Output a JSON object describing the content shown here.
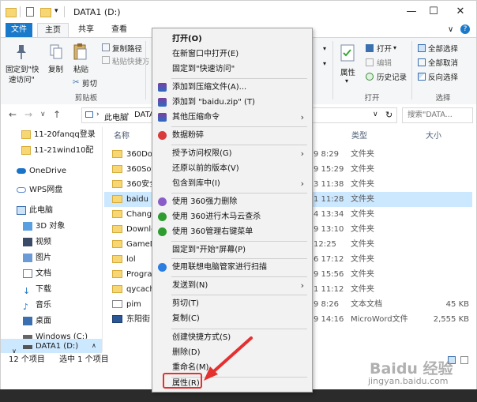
{
  "titlebar": {
    "title": "DATA1 (D:)",
    "minimize": "—",
    "maximize": "☐",
    "close": "✕"
  },
  "ribbon_tabs": {
    "file": "文件",
    "home": "主页",
    "share": "共享",
    "view": "查看"
  },
  "ribbon": {
    "pin_label": "固定到\"快",
    "pin_label2": "速访问\"",
    "copy_label": "复制",
    "paste_label": "粘贴",
    "copy_path": "复制路径",
    "paste_shortcut": "粘贴快捷方",
    "cut": "剪切",
    "clipboard_group": "剪贴板",
    "open": "打开",
    "edit": "编辑",
    "history": "历史记录",
    "properties": "属性",
    "open_group": "打开",
    "select_all": "全部选择",
    "select_none": "全部取消",
    "invert": "反向选择",
    "select_group": "选择"
  },
  "nav": {
    "back": "←",
    "forward": "→",
    "up_chevron": "∨",
    "up": "↑",
    "breadcrumb_pc": "此电脑",
    "breadcrumb_drive": "DATA",
    "search_placeholder": "搜索\"DATA...",
    "addr_chevron": "∨",
    "refresh": "↻"
  },
  "navpane": [
    {
      "label": "11-20fanqq登录",
      "kind": "folder"
    },
    {
      "label": "11-21wind10配",
      "kind": "folder"
    },
    {
      "label": "OneDrive",
      "kind": "cloud"
    },
    {
      "label": "WPS网盘",
      "kind": "cloud2"
    },
    {
      "label": "此电脑",
      "kind": "pc"
    },
    {
      "label": "3D 对象",
      "kind": "obj"
    },
    {
      "label": "视频",
      "kind": "video"
    },
    {
      "label": "图片",
      "kind": "pic"
    },
    {
      "label": "文档",
      "kind": "doc"
    },
    {
      "label": "下载",
      "kind": "dl"
    },
    {
      "label": "音乐",
      "kind": "music"
    },
    {
      "label": "桌面",
      "kind": "desk"
    },
    {
      "label": "Windows (C:)",
      "kind": "drive"
    },
    {
      "label": "DATA1 (D:)",
      "kind": "drive"
    }
  ],
  "columns": {
    "name": "名称",
    "type": "类型",
    "size": "大小"
  },
  "files": [
    {
      "name": "360Dov",
      "date": "9 8:29",
      "type": "文件夹",
      "size": ""
    },
    {
      "name": "360Sof",
      "date": "9 15:29",
      "type": "文件夹",
      "size": ""
    },
    {
      "name": "360安全",
      "date": "3 11:38",
      "type": "文件夹",
      "size": ""
    },
    {
      "name": "baidu",
      "date": "1 11:28",
      "type": "文件夹",
      "size": ""
    },
    {
      "name": "ChangZ",
      "date": "4 13:34",
      "type": "文件夹",
      "size": ""
    },
    {
      "name": "Downlo",
      "date": "9 13:10",
      "type": "文件夹",
      "size": ""
    },
    {
      "name": "GameD",
      "date": "12:25",
      "type": "文件夹",
      "size": ""
    },
    {
      "name": "lol",
      "date": "6 17:12",
      "type": "文件夹",
      "size": ""
    },
    {
      "name": "Progra",
      "date": "9 15:56",
      "type": "文件夹",
      "size": ""
    },
    {
      "name": "qycach",
      "date": "1 11:12",
      "type": "文件夹",
      "size": ""
    },
    {
      "name": "pim",
      "date": "9 8:26",
      "type": "文本文档",
      "size": "45 KB"
    },
    {
      "name": "东阳街",
      "date": "9 14:16",
      "type": "MicroWord文件",
      "size": "2,555 KB"
    }
  ],
  "status": {
    "count": "12 个项目",
    "selected": "选中 1 个项目"
  },
  "context_menu": {
    "open": "打开(O)",
    "open_new_window": "在新窗口中打开(E)",
    "pin_quick": "固定到\"快速访问\"",
    "add_archive": "添加到压缩文件(A)...",
    "add_zip": "添加到 \"baidu.zip\" (T)",
    "other_compress": "其他压缩命令",
    "shred": "数据粉碎",
    "give_access": "授予访问权限(G)",
    "restore": "还原以前的版本(V)",
    "include_library": "包含到库中(I)",
    "force_delete": "使用 360强力删除",
    "trojan_scan": "使用 360进行木马云查杀",
    "manage_menu": "使用 360管理右键菜单",
    "pin_start": "固定到\"开始\"屏幕(P)",
    "lenovo_scan": "使用联想电脑管家进行扫描",
    "send_to": "发送到(N)",
    "cut": "剪切(T)",
    "copy": "复制(C)",
    "create_shortcut": "创建快捷方式(S)",
    "delete": "删除(D)",
    "rename": "重命名(M)",
    "properties": "属性(R)",
    "submenu_arrow": "›"
  },
  "watermark": {
    "brand": "Baidu 经验",
    "url": "jingyan.baidu.com"
  },
  "colors": {
    "accent": "#1979ca",
    "selection": "#cce8ff",
    "highlight": "#e53030",
    "menu_bg": "#f2f2f2"
  }
}
